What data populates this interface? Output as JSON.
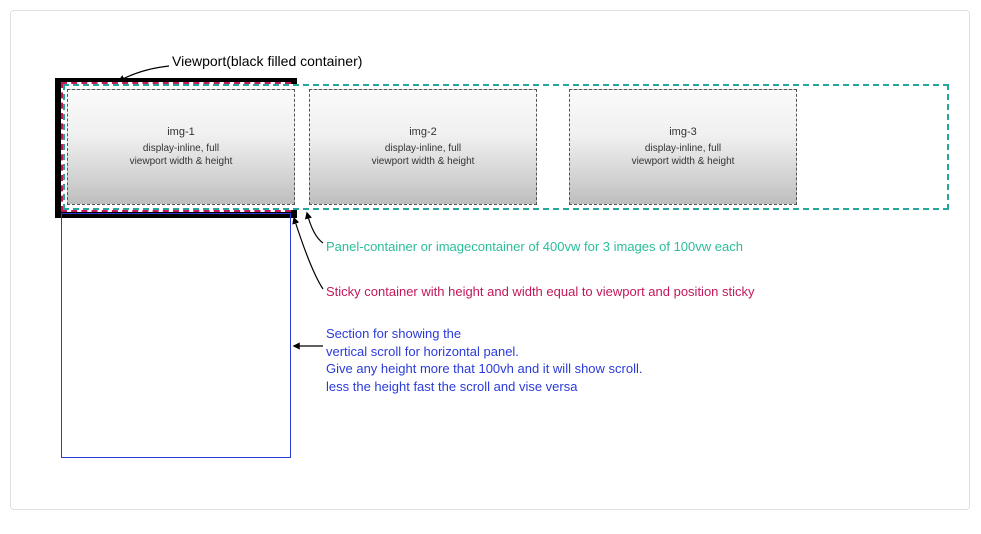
{
  "viewport_label": "Viewport(black filled container)",
  "images": [
    {
      "title": "img-1",
      "desc_l1": "display-inline, full",
      "desc_l2": "viewport width & height"
    },
    {
      "title": "img-2",
      "desc_l1": "display-inline, full",
      "desc_l2": "viewport width & height"
    },
    {
      "title": "img-3",
      "desc_l1": "display-inline, full",
      "desc_l2": "viewport width & height"
    }
  ],
  "green_label": "Panel-container or imagecontainer of 400vw for 3 images of 100vw each",
  "red_label": "Sticky container with height and width equal to viewport and position sticky",
  "blue_label_l1": "Section for  showing the",
  "blue_label_l2": "vertical scroll for horizontal panel.",
  "blue_label_l3": "Give any height more that 100vh and it will show scroll.",
  "blue_label_l4": "less the height fast the scroll and vise versa"
}
